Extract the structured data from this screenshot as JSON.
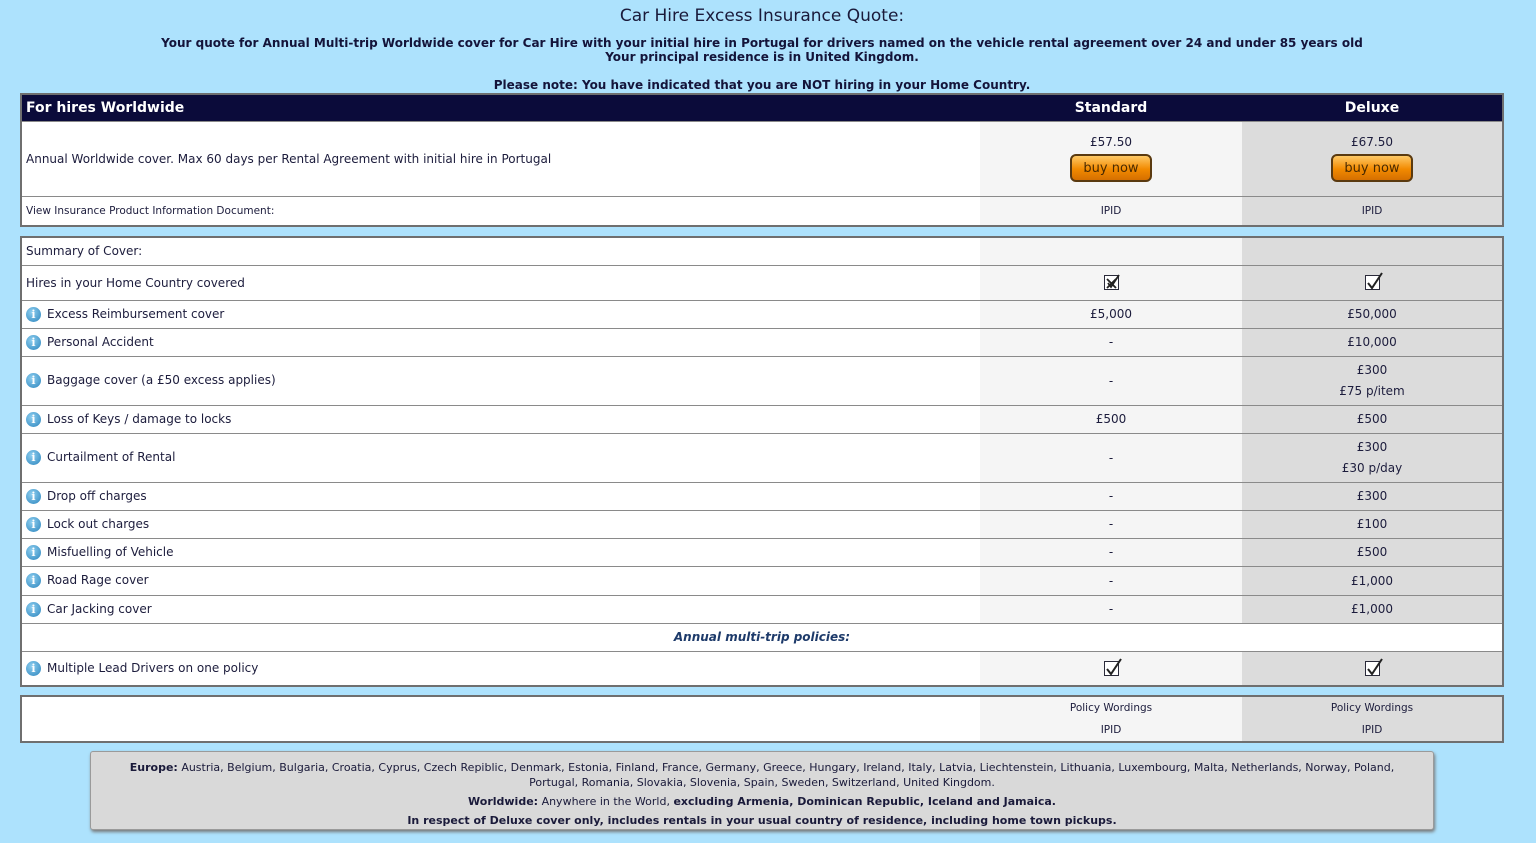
{
  "title": "Car Hire Excess Insurance Quote:",
  "subtitle_line1": "Your quote for Annual Multi-trip Worldwide cover for Car Hire with your initial hire in Portugal for drivers named on the vehicle rental agreement over 24 and under 85 years old",
  "subtitle_line2": "Your principal residence is in United Kingdom.",
  "note": "Please note: You have indicated that you are NOT hiring in your Home Country.",
  "header": {
    "label": "For hires Worldwide",
    "standard": "Standard",
    "deluxe": "Deluxe"
  },
  "cover": {
    "description": "Annual Worldwide cover. Max 60 days per Rental Agreement with initial hire in Portugal",
    "standard_price": "£57.50",
    "deluxe_price": "£67.50",
    "buy_label": "buy now"
  },
  "ipid_row": {
    "label": "View Insurance Product Information Document:",
    "standard": "IPID",
    "deluxe": "IPID"
  },
  "summary": {
    "heading": "Summary of Cover:",
    "home_country": {
      "label": "Hires in your Home Country covered",
      "standard": "crossed",
      "deluxe": "checked"
    },
    "rows": [
      {
        "label": "Excess Reimbursement cover",
        "standard": "£5,000",
        "deluxe": "£50,000",
        "deluxe2": ""
      },
      {
        "label": "Personal Accident",
        "standard": "-",
        "deluxe": "£10,000",
        "deluxe2": ""
      },
      {
        "label": "Baggage cover (a £50 excess applies)",
        "standard": "-",
        "deluxe": "£300",
        "deluxe2": "£75 p/item"
      },
      {
        "label": "Loss of Keys / damage to locks",
        "standard": "£500",
        "deluxe": "£500",
        "deluxe2": ""
      },
      {
        "label": "Curtailment of Rental",
        "standard": "-",
        "deluxe": "£300",
        "deluxe2": "£30 p/day"
      },
      {
        "label": "Drop off charges",
        "standard": "-",
        "deluxe": "£300",
        "deluxe2": ""
      },
      {
        "label": "Lock out charges",
        "standard": "-",
        "deluxe": "£100",
        "deluxe2": ""
      },
      {
        "label": "Misfuelling of Vehicle",
        "standard": "-",
        "deluxe": "£500",
        "deluxe2": ""
      },
      {
        "label": "Road Rage cover",
        "standard": "-",
        "deluxe": "£1,000",
        "deluxe2": ""
      },
      {
        "label": "Car Jacking cover",
        "standard": "-",
        "deluxe": "£1,000",
        "deluxe2": ""
      }
    ],
    "annual_heading": "Annual multi-trip policies:",
    "multi_driver": {
      "label": "Multiple Lead Drivers on one policy",
      "standard": "checked",
      "deluxe": "checked"
    }
  },
  "docs": {
    "wordings": "Policy Wordings",
    "ipid": "IPID"
  },
  "footer": {
    "europe_label": "Europe:",
    "europe_text": "Austria, Belgium, Bulgaria, Croatia, Cyprus, Czech Repiblic, Denmark, Estonia, Finland, France, Germany, Greece, Hungary, Ireland, Italy, Latvia, Liechtenstein, Lithuania, Luxembourg, Malta, Netherlands, Norway, Poland, Portugal, Romania, Slovakia, Slovenia, Spain, Sweden, Switzerland, United Kingdom.",
    "worldwide_label": "Worldwide:",
    "worldwide_text": "Anywhere in the World,",
    "worldwide_excl": "excluding Armenia, Dominican Republic, Iceland and Jamaica.",
    "deluxe_note": "In respect of Deluxe cover only, includes rentals in your usual country of residence, including home town pickups."
  }
}
